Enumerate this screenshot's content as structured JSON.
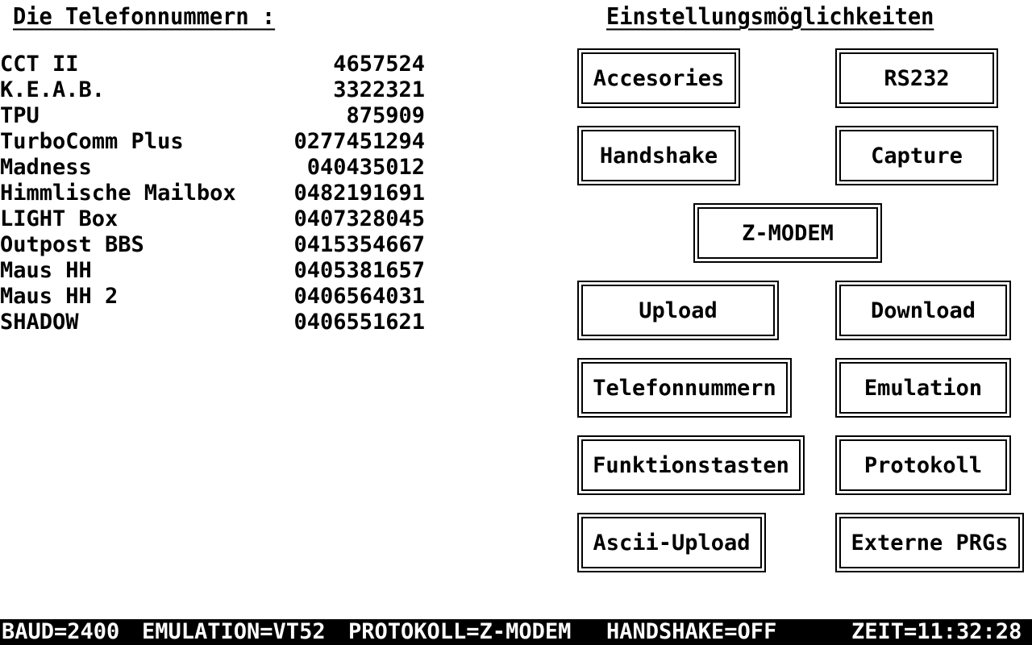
{
  "left_panel": {
    "heading": "Die Telefonnummern :",
    "entries": [
      {
        "name": "CCT II",
        "number": "4657524"
      },
      {
        "name": "K.E.A.B.",
        "number": "3322321"
      },
      {
        "name": "TPU",
        "number": "875909"
      },
      {
        "name": "TurboComm Plus",
        "number": "0277451294"
      },
      {
        "name": "Madness",
        "number": "040435012"
      },
      {
        "name": "Himmlische Mailbox",
        "number": "0482191691"
      },
      {
        "name": "LIGHT Box",
        "number": "0407328045"
      },
      {
        "name": "Outpost BBS",
        "number": "0415354667"
      },
      {
        "name": "Maus HH",
        "number": "0405381657"
      },
      {
        "name": "Maus HH 2",
        "number": "0406564031"
      },
      {
        "name": "SHADOW",
        "number": "0406551621"
      }
    ]
  },
  "right_panel": {
    "heading": "Einstellungsmöglichkeiten",
    "buttons": {
      "accessories": "Accesories",
      "rs232": "RS232",
      "handshake": "Handshake",
      "capture": "Capture",
      "zmodem": "Z-MODEM",
      "upload": "Upload",
      "download": "Download",
      "telefonnummern": "Telefonnummern",
      "emulation": "Emulation",
      "funktionstasten": "Funktionstasten",
      "protokoll": "Protokoll",
      "ascii_upload": "Ascii-Upload",
      "externe_prgs": "Externe PRGs"
    }
  },
  "status_bar": {
    "baud": "BAUD=2400",
    "emulation": "EMULATION=VT52",
    "protocol": "PROTOKOLL=Z-MODEM",
    "handshake": "HANDSHAKE=OFF",
    "time": "ZEIT=11:32:28"
  },
  "colors": {
    "background": "#ffffff",
    "foreground": "#000000",
    "status_background": "#000000",
    "status_foreground": "#ffffff"
  }
}
